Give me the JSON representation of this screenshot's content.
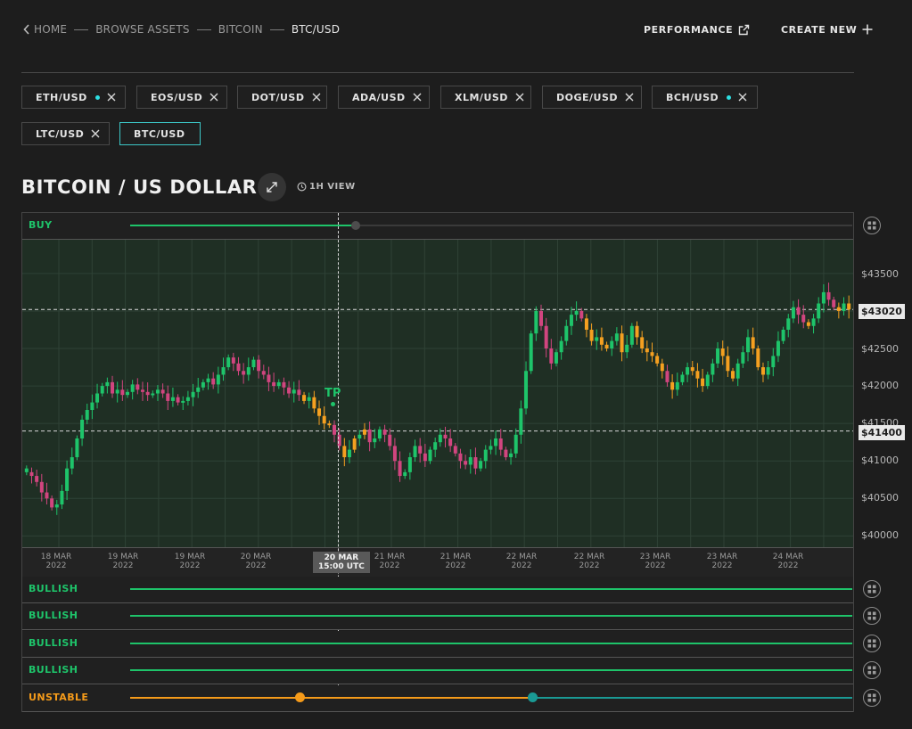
{
  "breadcrumb": {
    "home": "HOME",
    "browse": "BROWSE ASSETS",
    "asset": "BITCOIN",
    "current": "BTC/USD"
  },
  "header": {
    "performance": "PERFORMANCE",
    "create_new": "CREATE NEW"
  },
  "chips": [
    {
      "label": "ETH/USD",
      "dot": true
    },
    {
      "label": "EOS/USD",
      "dot": false
    },
    {
      "label": "DOT/USD",
      "dot": false
    },
    {
      "label": "ADA/USD",
      "dot": false
    },
    {
      "label": "XLM/USD",
      "dot": false
    },
    {
      "label": "DOGE/USD",
      "dot": false
    },
    {
      "label": "BCH/USD",
      "dot": true
    },
    {
      "label": "LTC/USD",
      "dot": false
    },
    {
      "label": "BTC/USD",
      "dot": false,
      "active": true
    }
  ],
  "title": "BITCOIN / US DOLLAR",
  "view_label": "1H VIEW",
  "signal_top": "BUY",
  "marker_label": "TP",
  "current_price": "$43020",
  "cursor_price": "$41400",
  "cursor_time": {
    "date": "20 MAR",
    "time": "15:00 UTC"
  },
  "indicators": [
    {
      "label": "BULLISH",
      "color": "#1ec46a"
    },
    {
      "label": "BULLISH",
      "color": "#1ec46a"
    },
    {
      "label": "BULLISH",
      "color": "#1ec46a"
    },
    {
      "label": "BULLISH",
      "color": "#1ec46a"
    },
    {
      "label": "UNSTABLE",
      "color": "#f59b1a"
    }
  ],
  "colors": {
    "up": "#1ec46a",
    "down": "#d1457f",
    "neutral": "#f5a020",
    "accent": "#2de0e3",
    "panel_bg": "#1f2f24"
  },
  "chart_data": {
    "type": "candlestick",
    "y_ticks": [
      "$43500",
      "$43000",
      "$42500",
      "$42000",
      "$41500",
      "$41000",
      "$40500",
      "$40000"
    ],
    "ylim": [
      39850,
      43950
    ],
    "x_ticks": [
      {
        "date": "18 MAR",
        "year": "2022"
      },
      {
        "date": "19 MAR",
        "year": "2022"
      },
      {
        "date": "19 MAR",
        "year": "2022"
      },
      {
        "date": "20 MAR",
        "year": "2022"
      },
      {
        "date": "2",
        "year": ""
      },
      {
        "date": "21 MAR",
        "year": "2022"
      },
      {
        "date": "21 MAR",
        "year": "2022"
      },
      {
        "date": "22 MAR",
        "year": "2022"
      },
      {
        "date": "22 MAR",
        "year": "2022"
      },
      {
        "date": "23 MAR",
        "year": "2022"
      },
      {
        "date": "23 MAR",
        "year": "2022"
      },
      {
        "date": "24 MAR",
        "year": "2022"
      }
    ],
    "closes": [
      40850,
      40800,
      40720,
      40580,
      40500,
      40380,
      40420,
      40600,
      40900,
      41050,
      41300,
      41550,
      41680,
      41780,
      41900,
      42000,
      42050,
      41900,
      41950,
      41880,
      41920,
      42020,
      41950,
      41920,
      41880,
      41900,
      41950,
      41900,
      41800,
      41850,
      41780,
      41800,
      41850,
      41920,
      41980,
      42050,
      42100,
      42020,
      42150,
      42250,
      42380,
      42300,
      42200,
      42150,
      42250,
      42350,
      42200,
      42150,
      42050,
      42000,
      42050,
      41980,
      41900,
      41950,
      41880,
      41800,
      41850,
      41700,
      41600,
      41500,
      41480,
      41350,
      41200,
      41050,
      41150,
      41300,
      41350,
      41420,
      41250,
      41300,
      41420,
      41350,
      41200,
      41000,
      40800,
      40850,
      41050,
      41200,
      41100,
      41000,
      41150,
      41250,
      41350,
      41300,
      41200,
      41100,
      41000,
      40950,
      41050,
      40900,
      41000,
      41150,
      41200,
      41300,
      41150,
      41050,
      41100,
      41350,
      41700,
      42200,
      42700,
      43000,
      42800,
      42500,
      42300,
      42450,
      42600,
      42800,
      42950,
      43000,
      42900,
      42750,
      42600,
      42650,
      42550,
      42500,
      42600,
      42700,
      42450,
      42550,
      42800,
      42650,
      42500,
      42450,
      42400,
      42300,
      42200,
      42050,
      41950,
      42050,
      42150,
      42250,
      42200,
      42100,
      42000,
      42150,
      42300,
      42500,
      42400,
      42200,
      42100,
      42300,
      42450,
      42650,
      42500,
      42250,
      42150,
      42250,
      42400,
      42600,
      42750,
      42900,
      43050,
      42950,
      42850,
      42800,
      42900,
      43100,
      43250,
      43150,
      43050,
      43000,
      43100,
      43020
    ],
    "colors": [
      0,
      1,
      1,
      1,
      1,
      1,
      0,
      0,
      0,
      0,
      0,
      0,
      0,
      0,
      0,
      0,
      0,
      1,
      0,
      1,
      0,
      0,
      1,
      1,
      1,
      0,
      0,
      1,
      1,
      0,
      1,
      0,
      0,
      0,
      0,
      0,
      0,
      1,
      0,
      0,
      0,
      1,
      1,
      1,
      0,
      0,
      1,
      1,
      1,
      1,
      0,
      1,
      1,
      0,
      1,
      2,
      0,
      2,
      2,
      2,
      2,
      1,
      1,
      2,
      0,
      2,
      0,
      2,
      1,
      0,
      0,
      1,
      1,
      1,
      1,
      0,
      0,
      0,
      1,
      1,
      0,
      0,
      0,
      1,
      1,
      1,
      1,
      1,
      0,
      1,
      0,
      0,
      0,
      0,
      1,
      1,
      0,
      0,
      0,
      0,
      0,
      0,
      1,
      1,
      1,
      0,
      0,
      0,
      0,
      0,
      1,
      2,
      2,
      0,
      2,
      2,
      0,
      0,
      2,
      0,
      0,
      2,
      2,
      2,
      2,
      2,
      2,
      1,
      2,
      0,
      0,
      0,
      2,
      2,
      2,
      0,
      0,
      0,
      2,
      2,
      2,
      0,
      0,
      0,
      2,
      2,
      2,
      0,
      0,
      0,
      0,
      0,
      0,
      1,
      1,
      2,
      0,
      0,
      0,
      1,
      1,
      2,
      0,
      2
    ]
  }
}
